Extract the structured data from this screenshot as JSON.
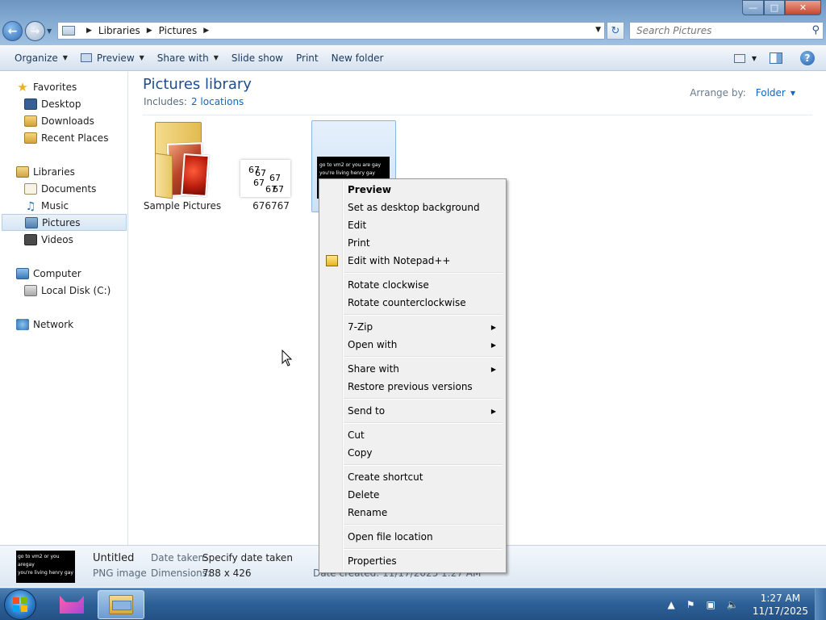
{
  "window": {
    "minimize_glyph": "—",
    "maximize_glyph": "□",
    "close_glyph": "✕"
  },
  "address": {
    "crumbs": [
      "Libraries",
      "Pictures"
    ],
    "search_placeholder": "Search Pictures"
  },
  "toolbar": {
    "organize": "Organize",
    "preview": "Preview",
    "share_with": "Share with",
    "slide_show": "Slide show",
    "print": "Print",
    "new_folder": "New folder"
  },
  "navpane": {
    "favorites": "Favorites",
    "desktop": "Desktop",
    "downloads": "Downloads",
    "recent_places": "Recent Places",
    "libraries": "Libraries",
    "documents": "Documents",
    "music": "Music",
    "pictures": "Pictures",
    "videos": "Videos",
    "computer": "Computer",
    "local_disk": "Local Disk (C:)",
    "network": "Network"
  },
  "library": {
    "title": "Pictures library",
    "includes_label": "Includes:",
    "includes_link": "2 locations",
    "arrange_label": "Arrange by:",
    "arrange_value": "Folder"
  },
  "files": {
    "sample_pictures": "Sample Pictures",
    "numbers_file": "676767",
    "numbers_thumb": [
      "67",
      "67",
      "67",
      "67",
      "67",
      "67"
    ],
    "selected_thumb_lines": [
      "go to vm2 or you are gay",
      "you're living henry gay"
    ]
  },
  "context_menu": {
    "preview": "Preview",
    "set_background": "Set as desktop background",
    "edit": "Edit",
    "print": "Print",
    "edit_notepad": "Edit with Notepad++",
    "rotate_cw": "Rotate clockwise",
    "rotate_ccw": "Rotate counterclockwise",
    "seven_zip": "7-Zip",
    "open_with": "Open with",
    "share_with": "Share with",
    "restore_versions": "Restore previous versions",
    "send_to": "Send to",
    "cut": "Cut",
    "copy": "Copy",
    "create_shortcut": "Create shortcut",
    "delete": "Delete",
    "rename": "Rename",
    "open_location": "Open file location",
    "properties": "Properties"
  },
  "details": {
    "thumb_lines": [
      "go to vm2 or you aregay",
      "you're living henry gay"
    ],
    "name": "Untitled",
    "type": "PNG image",
    "date_taken_label": "Date taken:",
    "date_taken_value": "Specify date taken",
    "dimensions_label": "Dimensions:",
    "dimensions_value": "788 x 426",
    "date_created_partial": "Date created: 11/17/2025 1:27 AM"
  },
  "taskbar": {
    "time": "1:27 AM",
    "date": "11/17/2025"
  },
  "colors": {
    "accent_link": "#1565c0",
    "library_title": "#1e4c8a",
    "menu_bg": "#f0f0f0"
  }
}
